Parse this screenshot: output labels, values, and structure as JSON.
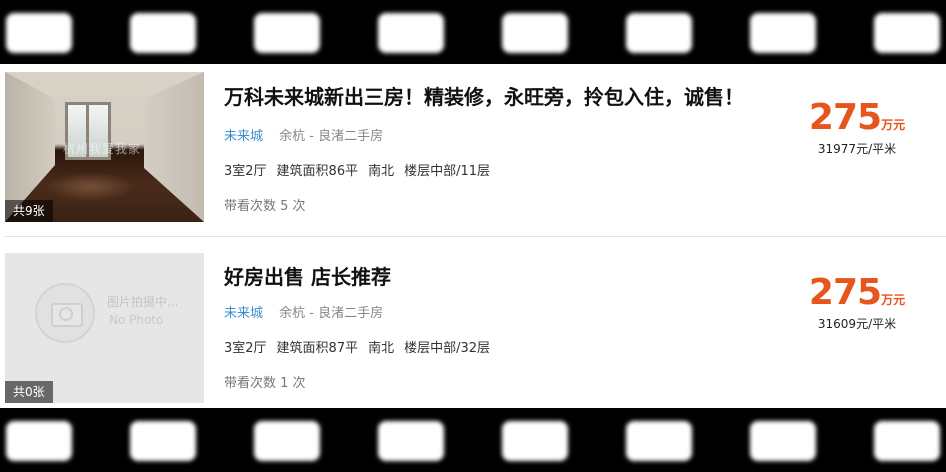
{
  "listings": [
    {
      "title": "万科未来城新出三房！精装修，永旺旁，拎包入住，诚售！",
      "community": "未来城",
      "district": "余杭 - 良渚二手房",
      "layout": "3室2厅",
      "area": "建筑面积86平",
      "orientation": "南北",
      "floor": "楼层中部/11层",
      "views": "带看次数 5 次",
      "price": "275",
      "price_unit": "万元",
      "unit_price": "31977元/平米",
      "photo_count": "共9张",
      "watermark": "杭州我爱我家"
    },
    {
      "title": "好房出售 店长推荐",
      "community": "未来城",
      "district": "余杭 - 良渚二手房",
      "layout": "3室2厅",
      "area": "建筑面积87平",
      "orientation": "南北",
      "floor": "楼层中部/32层",
      "views": "带看次数 1 次",
      "price": "275",
      "price_unit": "万元",
      "unit_price": "31609元/平米",
      "photo_count": "共0张",
      "no_photo_cn": "图片拍摄中...",
      "no_photo_en": "No Photo"
    }
  ]
}
